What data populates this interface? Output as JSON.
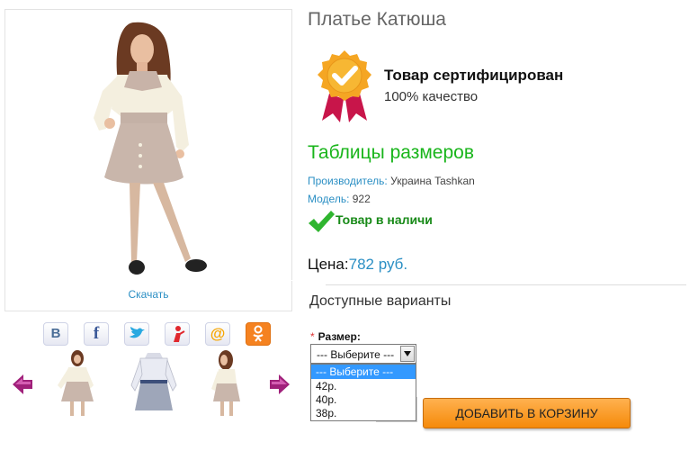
{
  "product": {
    "title": "Платье Катюша",
    "download_label": "Скачать",
    "certificate": {
      "title": "Товар сертифицирован",
      "subtitle": "100% качество"
    },
    "size_table_label": "Таблицы размеров",
    "manufacturer": {
      "key": "Производитель:",
      "value": "Украина Tashkan"
    },
    "model": {
      "key": "Модель:",
      "value": "922"
    },
    "stock_label": "Товар в наличи",
    "price": {
      "key": "Цена:",
      "value": "782 руб."
    }
  },
  "social": [
    {
      "name": "vkontakte-icon",
      "glyph": "В",
      "color": "#4a6d97"
    },
    {
      "name": "facebook-icon",
      "glyph": "f",
      "color": "#3b5998"
    },
    {
      "name": "twitter-icon",
      "glyph": "",
      "color": "#29a9e1"
    },
    {
      "name": "moikrug-icon",
      "glyph": "",
      "color": "#e0272d"
    },
    {
      "name": "mailru-icon",
      "glyph": "@",
      "color": "#f7a600"
    },
    {
      "name": "odnoklassniki-icon",
      "glyph": "",
      "color": "#f58220"
    }
  ],
  "options": {
    "title": "Доступные варианты",
    "size_label": "Размер:",
    "required_mark": "*",
    "selected": "--- Выберите ---",
    "list": [
      "--- Выберите ---",
      "42р.",
      "40р.",
      "38р."
    ]
  },
  "cart_button": "ДОБАВИТЬ В КОРЗИНУ",
  "colors": {
    "accent_blue": "#2b8fc4",
    "green": "#19b51b",
    "orange": "#f58a0a",
    "arrow": "#a0207a"
  }
}
